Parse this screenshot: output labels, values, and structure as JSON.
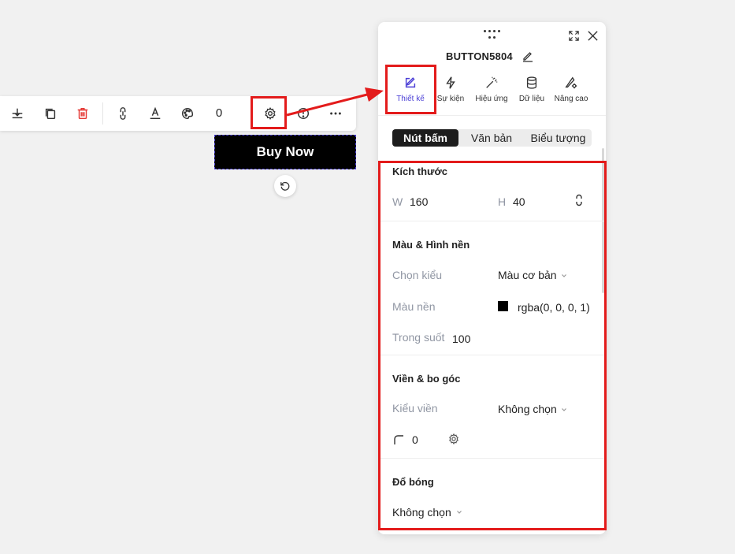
{
  "toolbar": {
    "count": "0",
    "items": [
      "align-bottom-icon",
      "duplicate-icon",
      "delete-icon",
      "link-icon",
      "text-style-icon",
      "palette-icon",
      "settings-icon",
      "info-icon",
      "more-icon"
    ]
  },
  "canvas": {
    "button_label": "Buy Now"
  },
  "panel": {
    "title": "BUTTON5804",
    "tabs": [
      {
        "label": "Thiết kế",
        "icon": "edit-icon",
        "active": true
      },
      {
        "label": "Sự kiện",
        "icon": "lightning-icon",
        "active": false
      },
      {
        "label": "Hiệu ứng",
        "icon": "magic-wand-icon",
        "active": false
      },
      {
        "label": "Dữ liệu",
        "icon": "database-icon",
        "active": false
      },
      {
        "label": "Nâng cao",
        "icon": "advanced-settings-icon",
        "active": false
      }
    ],
    "segments": [
      "Nút bấm",
      "Văn bản",
      "Biểu tượng"
    ],
    "size": {
      "title": "Kích thước",
      "w_label": "W",
      "w_value": "160",
      "h_label": "H",
      "h_value": "40"
    },
    "color_bg": {
      "title": "Màu & Hình nền",
      "style_label": "Chọn kiểu",
      "style_value": "Màu cơ bản",
      "bg_label": "Màu nền",
      "bg_value": "rgba(0, 0, 0, 1)",
      "bg_swatch": "#000000",
      "opacity_label": "Trong suốt",
      "opacity_value": "100"
    },
    "border": {
      "title": "Viền & bo góc",
      "style_label": "Kiểu viền",
      "style_value": "Không chọn",
      "radius_value": "0"
    },
    "shadow": {
      "title": "Đổ bóng",
      "value": "Không chọn"
    }
  },
  "colors": {
    "accent": "#4b3fd6",
    "highlight": "#e31b1b",
    "delete": "#e53935"
  }
}
